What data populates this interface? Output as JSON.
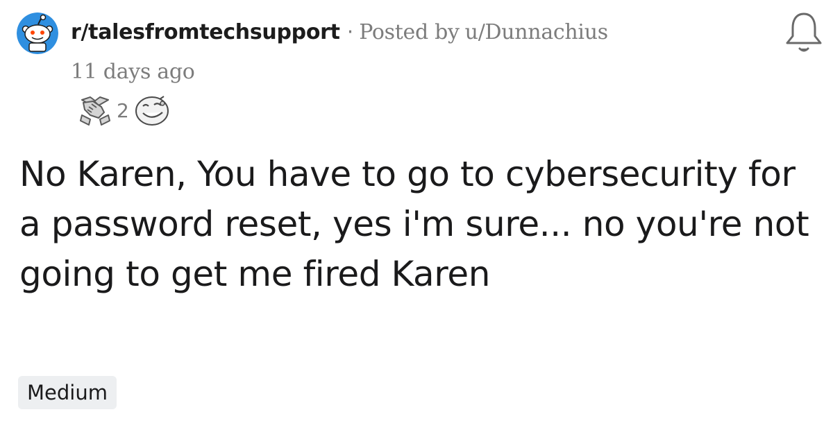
{
  "post": {
    "subreddit": "r/talesfromtechsupport",
    "separator": "·",
    "posted_by_label": "Posted by",
    "author": "u/Dunnachius",
    "timestamp": "11 days ago",
    "award_count": "2",
    "title": "No Karen, You have to go to cybersecurity for a password reset, yes i'm sure... no you're not going to get me fired Karen",
    "flair": "Medium"
  },
  "icons": {
    "subreddit_avatar": "snoo-icon",
    "award_1": "handshake-award-icon",
    "award_2": "smiley-award-icon",
    "notification": "bell-icon"
  },
  "colors": {
    "meta_gray": "#7c7c7c",
    "title_text": "#1a1a1b",
    "flair_bg": "#edeff1",
    "avatar_blue": "#2f8fe0"
  }
}
